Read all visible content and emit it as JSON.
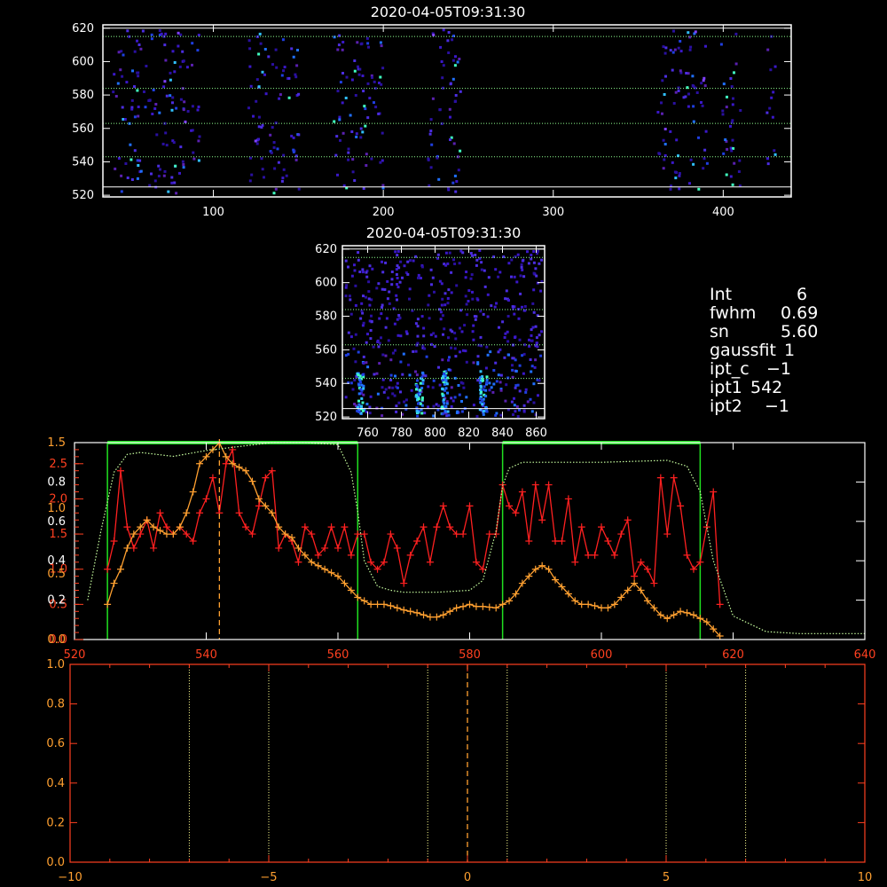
{
  "panel1": {
    "title": "2020-04-05T09:31:30",
    "xticks": [
      "100",
      "200",
      "300",
      "400"
    ],
    "yticks": [
      "520",
      "540",
      "560",
      "580",
      "600",
      "620"
    ]
  },
  "panel2": {
    "title": "2020-04-05T09:31:30",
    "xticks": [
      "760",
      "780",
      "800",
      "820",
      "840",
      "860"
    ],
    "yticks": [
      "520",
      "540",
      "560",
      "580",
      "600",
      "620"
    ]
  },
  "info": [
    {
      "key": "Int",
      "value": "6"
    },
    {
      "key": "fwhm",
      "value": "0.69"
    },
    {
      "key": "sn",
      "value": "5.60"
    },
    {
      "key": "gaussfit",
      "value": "1"
    },
    {
      "key": "ipt_c",
      "value": "−1"
    },
    {
      "key": "ipt1",
      "value": "542"
    },
    {
      "key": "ipt2",
      "value": "−1"
    }
  ],
  "colors": {
    "red": "#ff2020",
    "orange": "#ffa030",
    "green": "#20e020",
    "dotted_green": "#c8ffa0",
    "axis": "#ffffff",
    "axis_red": "#ff4020"
  },
  "chart_data": [
    {
      "type": "heatmap",
      "title": "2020-04-05T09:31:30",
      "xlim": [
        35,
        440
      ],
      "ylim": [
        519,
        622
      ],
      "hlines_y": [
        525,
        543,
        563,
        584,
        615,
        620
      ],
      "vertical_bands_x": [
        [
          40,
          92
        ],
        [
          120,
          150
        ],
        [
          170,
          200
        ],
        [
          225,
          245
        ],
        [
          360,
          390
        ],
        [
          398,
          410
        ],
        [
          425,
          430
        ]
      ]
    },
    {
      "type": "heatmap",
      "title": "2020-04-05T09:31:30",
      "xlim": [
        745,
        865
      ],
      "ylim": [
        519,
        622
      ],
      "hlines_y": [
        525,
        543,
        563,
        584,
        615,
        620
      ],
      "bright_columns_x": [
        755,
        790,
        805,
        828
      ]
    },
    {
      "type": "line",
      "xlim": [
        520,
        640
      ],
      "ylim_left_red": [
        0,
        2.8
      ],
      "ylim_left_white": [
        0,
        1.0
      ],
      "xticks": [
        "520",
        "540",
        "560",
        "580",
        "600",
        "620",
        "640"
      ],
      "yticks_red": [
        "0.0",
        "0.5",
        "1.0",
        "1.5",
        "2.0",
        "2.5"
      ],
      "yticks_white": [
        "0.2",
        "0.4",
        "0.6",
        "0.8"
      ],
      "yticks_orange": [
        "0.0",
        "0.5",
        "1.0",
        "1.5"
      ],
      "green_box_x_ranges": [
        [
          525,
          563
        ],
        [
          585,
          615
        ]
      ],
      "marker_x": 542,
      "series": [
        {
          "color": "red",
          "x": [
            525,
            526,
            527,
            528,
            529,
            530,
            531,
            532,
            533,
            534,
            535,
            536,
            537,
            538,
            539,
            540,
            541,
            542,
            543,
            544,
            545,
            546,
            547,
            548,
            549,
            550,
            551,
            552,
            553,
            554,
            555,
            556,
            557,
            558,
            559,
            560,
            561,
            562,
            563,
            564,
            565,
            566,
            567,
            568,
            569,
            570,
            571,
            572,
            573,
            574,
            575,
            576,
            577,
            578,
            579,
            580,
            581,
            582,
            583,
            584,
            585,
            586,
            587,
            588,
            589,
            590,
            591,
            592,
            593,
            594,
            595,
            596,
            597,
            598,
            599,
            600,
            601,
            602,
            603,
            604,
            605,
            606,
            607,
            608,
            609,
            610,
            611,
            612,
            613,
            614,
            615,
            616,
            617,
            618
          ],
          "y": [
            1.0,
            1.4,
            2.4,
            1.6,
            1.3,
            1.5,
            1.7,
            1.3,
            1.8,
            1.6,
            1.5,
            1.6,
            1.5,
            1.4,
            1.8,
            2.0,
            2.3,
            1.8,
            2.5,
            2.7,
            1.8,
            1.6,
            1.5,
            1.9,
            2.3,
            2.4,
            1.3,
            1.5,
            1.4,
            1.1,
            1.6,
            1.5,
            1.2,
            1.3,
            1.6,
            1.3,
            1.6,
            1.2,
            1.5,
            1.5,
            1.1,
            1.0,
            1.1,
            1.5,
            1.3,
            0.8,
            1.2,
            1.4,
            1.6,
            1.1,
            1.6,
            1.9,
            1.6,
            1.5,
            1.5,
            1.9,
            1.1,
            1.0,
            1.5,
            1.5,
            2.2,
            1.9,
            1.8,
            2.1,
            1.4,
            2.2,
            1.7,
            2.2,
            1.4,
            1.4,
            2.0,
            1.1,
            1.6,
            1.2,
            1.2,
            1.6,
            1.4,
            1.2,
            1.5,
            1.7,
            0.9,
            1.1,
            1.0,
            0.8,
            2.3,
            1.5,
            2.3,
            1.9,
            1.2,
            1.0,
            1.1,
            1.6,
            2.1,
            0.5
          ]
        },
        {
          "color": "orange",
          "x": [
            525,
            526,
            527,
            528,
            529,
            530,
            531,
            532,
            533,
            534,
            535,
            536,
            537,
            538,
            539,
            540,
            541,
            542,
            543,
            544,
            545,
            546,
            547,
            548,
            549,
            550,
            551,
            552,
            553,
            554,
            555,
            556,
            557,
            558,
            559,
            560,
            561,
            562,
            563,
            564,
            565,
            566,
            567,
            568,
            569,
            570,
            571,
            572,
            573,
            574,
            575,
            576,
            577,
            578,
            579,
            580,
            581,
            582,
            583,
            584,
            585,
            586,
            587,
            588,
            589,
            590,
            591,
            592,
            593,
            594,
            595,
            596,
            597,
            598,
            599,
            600,
            601,
            602,
            603,
            604,
            605,
            606,
            607,
            608,
            609,
            610,
            611,
            612,
            613,
            614,
            615,
            616,
            617,
            618
          ],
          "y": [
            0.5,
            0.8,
            1.0,
            1.3,
            1.5,
            1.6,
            1.7,
            1.6,
            1.55,
            1.5,
            1.5,
            1.6,
            1.8,
            2.1,
            2.5,
            2.6,
            2.7,
            2.8,
            2.6,
            2.5,
            2.45,
            2.4,
            2.25,
            2.0,
            1.9,
            1.8,
            1.6,
            1.5,
            1.45,
            1.3,
            1.2,
            1.1,
            1.05,
            1.0,
            0.95,
            0.9,
            0.8,
            0.7,
            0.6,
            0.55,
            0.5,
            0.5,
            0.5,
            0.48,
            0.45,
            0.42,
            0.4,
            0.38,
            0.35,
            0.32,
            0.32,
            0.35,
            0.4,
            0.45,
            0.47,
            0.5,
            0.47,
            0.47,
            0.46,
            0.45,
            0.5,
            0.55,
            0.65,
            0.8,
            0.9,
            1.0,
            1.05,
            1.0,
            0.85,
            0.75,
            0.65,
            0.55,
            0.5,
            0.5,
            0.48,
            0.45,
            0.45,
            0.5,
            0.6,
            0.7,
            0.8,
            0.7,
            0.55,
            0.45,
            0.35,
            0.3,
            0.35,
            0.4,
            0.38,
            0.35,
            0.3,
            0.25,
            0.15,
            0.05
          ]
        },
        {
          "color": "dotted_green",
          "x": [
            522,
            524,
            526,
            528,
            530,
            535,
            540,
            545,
            550,
            555,
            560,
            562,
            563,
            564,
            566,
            568,
            570,
            575,
            580,
            582,
            584,
            585,
            586,
            588,
            590,
            600,
            610,
            613,
            615,
            617,
            620,
            625,
            630,
            640
          ],
          "y": [
            0.2,
            0.55,
            0.85,
            0.94,
            0.95,
            0.93,
            0.96,
            0.98,
            1.0,
            1.0,
            0.99,
            0.85,
            0.65,
            0.4,
            0.27,
            0.25,
            0.24,
            0.24,
            0.25,
            0.3,
            0.55,
            0.78,
            0.87,
            0.9,
            0.9,
            0.9,
            0.91,
            0.88,
            0.75,
            0.4,
            0.12,
            0.04,
            0.03,
            0.03
          ]
        }
      ]
    },
    {
      "type": "line",
      "xlim": [
        -10,
        10
      ],
      "ylim": [
        0.0,
        1.0
      ],
      "xticks": [
        "−10",
        "−5",
        "0",
        "5",
        "10"
      ],
      "yticks": [
        "0.0",
        "0.2",
        "0.4",
        "0.6",
        "0.8",
        "1.0"
      ],
      "dotted_vlines_x": [
        -7,
        -5,
        -1,
        1,
        5,
        7
      ],
      "dashed_vline_x": 0,
      "series": []
    }
  ]
}
